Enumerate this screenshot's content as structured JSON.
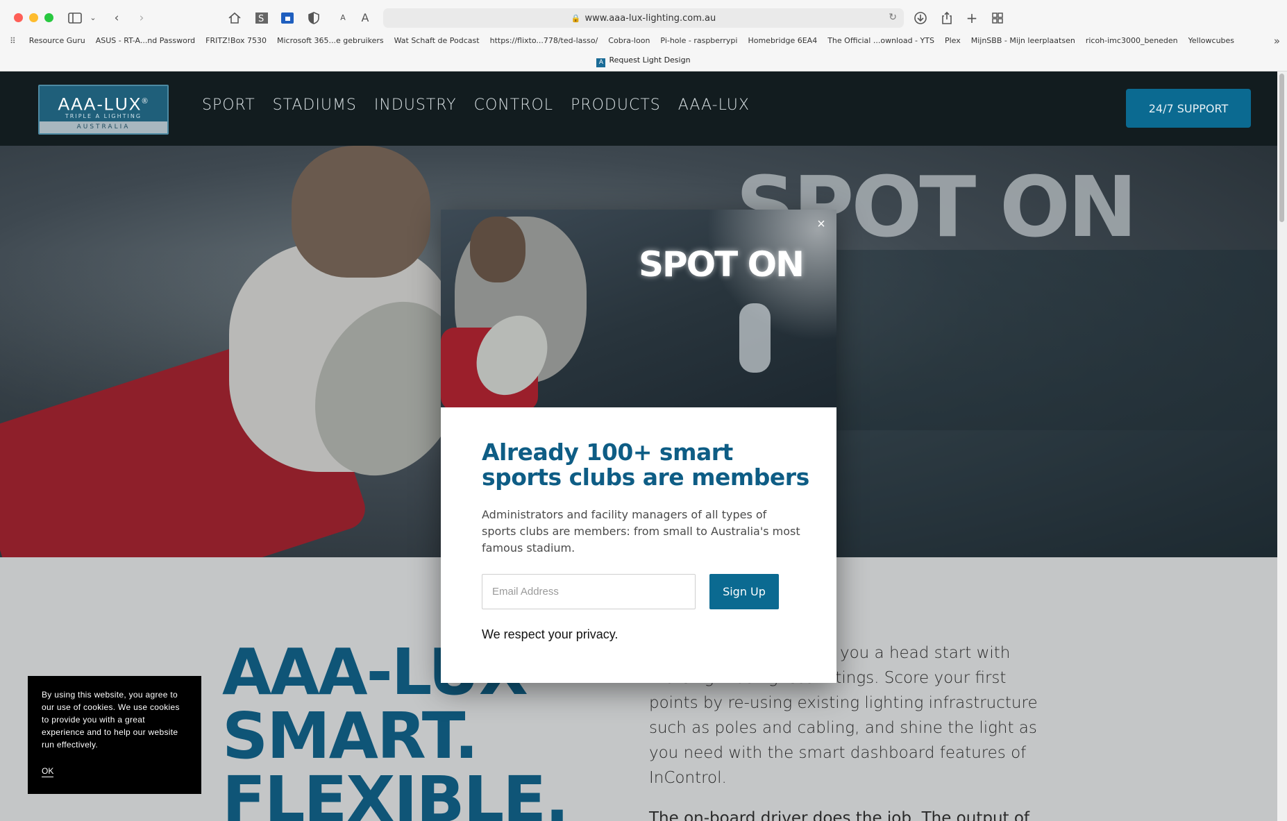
{
  "browser": {
    "url": "www.aaa-lux-lighting.com.au",
    "tab_title": "Request Light Design",
    "bookmarks": [
      "Resource Guru",
      "ASUS - RT-A...nd Password",
      "FRITZ!Box 7530",
      "Microsoft 365...e gebruikers",
      "Wat Schaft de Podcast",
      "https://flixto...778/ted-lasso/",
      "Cobra-loon",
      "Pi-hole - raspberrypi",
      "Homebridge 6EA4",
      "The Official ...ownload - YTS",
      "Plex",
      "MijnSBB - Mijn leerplaatsen",
      "ricoh-imc3000_beneden",
      "Yellowcubes"
    ],
    "reader_small": "A",
    "reader_large": "A"
  },
  "site": {
    "logo": {
      "name": "AAA-LUX",
      "reg": "®",
      "tagline": "TRIPLE A LIGHTING",
      "region": "AUSTRALIA"
    },
    "nav": [
      "SPORT",
      "STADIUMS",
      "INDUSTRY",
      "CONTROL",
      "PRODUCTS",
      "AAA-LUX"
    ],
    "support_label": "24/7 SUPPORT",
    "hero_text": "SPOT ON",
    "content": {
      "title_lines": [
        "AAA-LUX",
        "SMART.",
        "FLEXIBLE."
      ],
      "paragraph1": "...LUX technology gives you a head start with more light using less fittings. Score your first points by re-using existing lighting infrastructure such as poles and cabling, and shine the light as you need with the smart dashboard features of InControl.",
      "paragraph2": "The on-board driver does the job. The output of the"
    }
  },
  "modal": {
    "image_text": "SPOT ON",
    "close_glyph": "×",
    "heading": "Already 100+ smart sports clubs are members",
    "description": "Administrators and facility managers of all types of sports clubs are members: from small to Australia's most famous stadium.",
    "email_placeholder": "Email Address",
    "signup_label": "Sign Up",
    "privacy": "We respect your privacy."
  },
  "cookie": {
    "text": "By using this website, you agree to our use of cookies. We use cookies to provide you with a great experience and to help our website run effectively.",
    "ok_label": "OK"
  },
  "colors": {
    "brand_blue": "#0b6a91",
    "heading_blue": "#0e5d85",
    "header_bg": "#121c1f"
  }
}
